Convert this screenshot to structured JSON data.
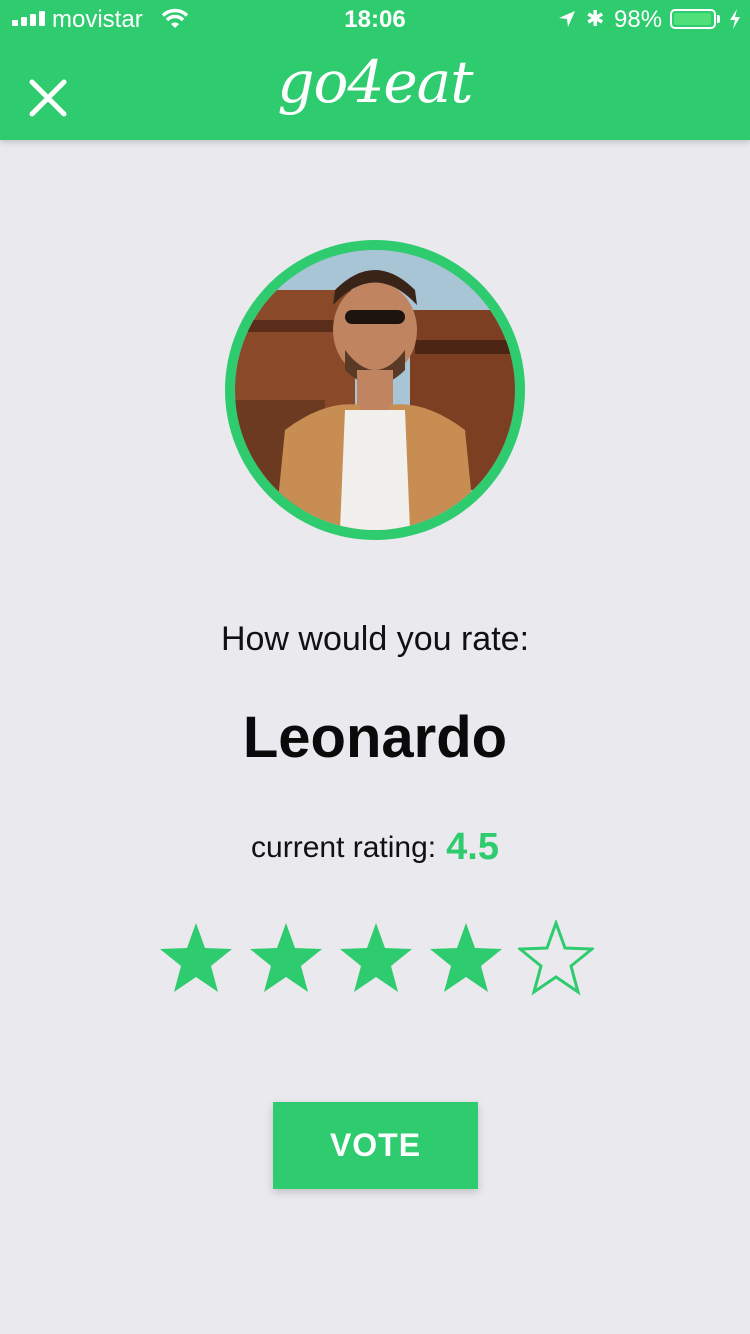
{
  "status_bar": {
    "carrier": "movistar",
    "time": "18:06",
    "battery_percent": "98%",
    "battery_level": 0.98
  },
  "header": {
    "logo_text": "go4eat",
    "close_icon": "close-icon"
  },
  "profile": {
    "prompt": "How would you rate:",
    "name": "Leonardo",
    "current_rating_label": "current rating:",
    "current_rating_value": "4.5"
  },
  "stars": {
    "filled": 4,
    "total": 5,
    "color": "#2ecc6f"
  },
  "actions": {
    "vote_label": "VOTE"
  },
  "colors": {
    "accent": "#2ecc6f",
    "background": "#e9e9ee"
  }
}
